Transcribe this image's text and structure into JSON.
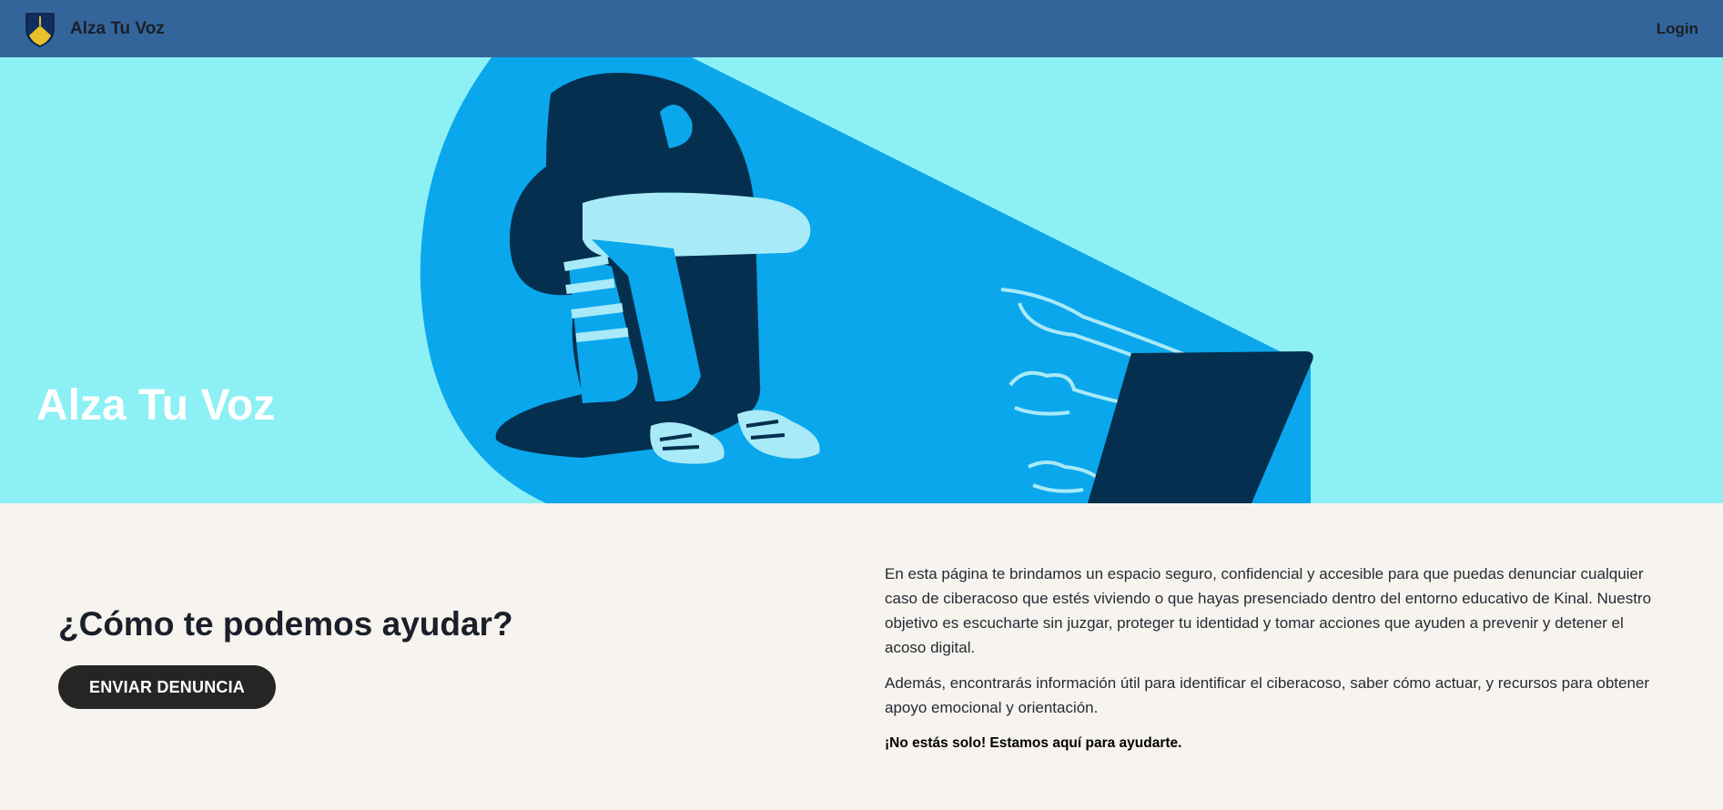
{
  "navbar": {
    "brand_name": "Alza Tu Voz",
    "login_label": "Login",
    "background": "#33659b",
    "logo_icon": "shield-logo-icon"
  },
  "hero": {
    "title": "Alza Tu Voz",
    "background": "#8cf0f4",
    "illustration": "person-hugging-knees-with-laptop-and-pointing-hands"
  },
  "help": {
    "title": "¿Cómo te podemos ayudar?",
    "button_label": "ENVIAR DENUNCIA"
  },
  "info": {
    "paragraph1": "En esta página te brindamos un espacio seguro, confidencial y accesible para que puedas denunciar cualquier caso de ciberacoso que estés viviendo o que hayas presenciado dentro del entorno educativo de Kinal. Nuestro objetivo es escucharte sin juzgar, proteger tu identidad y tomar acciones que ayuden a prevenir y detener el acoso digital.",
    "paragraph2": "Además, encontrarás información útil para identificar el ciberacoso, saber cómo actuar, y recursos para obtener apoyo emocional y orientación.",
    "emphasis": "¡No estás solo! Estamos aquí para ayudarte."
  }
}
